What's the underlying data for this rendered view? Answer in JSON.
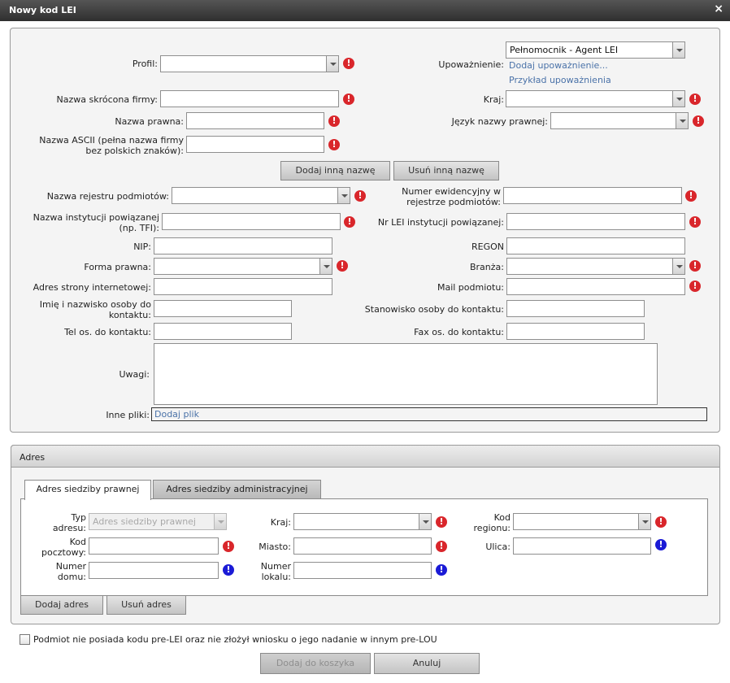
{
  "window": {
    "title": "Nowy kod LEI",
    "close_glyph": "×"
  },
  "form": {
    "profil_label": "Profil:",
    "upowaznienie_label": "Upoważnienie:",
    "upowaznienie_value": "Pełnomocnik - Agent LEI",
    "dodaj_upowaznienie_link": "Dodaj upoważnienie...",
    "przyklad_link": "Przykład upoważnienia",
    "nazwa_skrocona_label": "Nazwa skrócona firmy:",
    "kraj_label": "Kraj:",
    "nazwa_prawna_label": "Nazwa prawna:",
    "jezyk_label": "Język nazwy prawnej:",
    "nazwa_ascii_label_1": "Nazwa ASCII (pełna nazwa firmy",
    "nazwa_ascii_label_2": "bez polskich znaków):",
    "dodaj_nazwe_button": "Dodaj inną nazwę",
    "usun_nazwe_button": "Usuń inną nazwę",
    "nazwa_rejestru_label": "Nazwa rejestru podmiotów:",
    "numer_ewid_label_1": "Numer ewidencyjny w",
    "numer_ewid_label_2": "rejestrze podmiotów:",
    "instytucja_label_1": "Nazwa instytucji powiązanej",
    "instytucja_label_2": "(np. TFI):",
    "nr_lei_label": "Nr LEI instytucji powiązanej:",
    "nip_label": "NIP:",
    "regon_label": "REGON",
    "forma_label": "Forma prawna:",
    "branza_label": "Branża:",
    "www_label": "Adres strony internetowej:",
    "mail_label": "Mail podmiotu:",
    "osoba_label_1": "Imię i nazwisko osoby do",
    "osoba_label_2": "kontaktu:",
    "stanowisko_label": "Stanowisko osoby do kontaktu:",
    "tel_label": "Tel os. do kontaktu:",
    "fax_label": "Fax os. do kontaktu:",
    "uwagi_label": "Uwagi:",
    "pliki_label": "Inne pliki:",
    "dodaj_plik_link": "Dodaj plik"
  },
  "adres": {
    "header": "Adres",
    "tabs": [
      {
        "label": "Adres siedziby prawnej"
      },
      {
        "label": "Adres siedziby administracyjnej"
      }
    ],
    "typ_label_1": "Typ",
    "typ_label_2": "adresu:",
    "typ_value": "Adres siedziby prawnej",
    "kraj_label": "Kraj:",
    "kod_regionu_label_1": "Kod",
    "kod_regionu_label_2": "regionu:",
    "kod_pocztowy_label_1": "Kod",
    "kod_pocztowy_label_2": "pocztowy:",
    "miasto_label": "Miasto:",
    "ulica_label": "Ulica:",
    "numer_domu_label_1": "Numer",
    "numer_domu_label_2": "domu:",
    "numer_lokalu_label_1": "Numer",
    "numer_lokalu_label_2": "lokalu:",
    "dodaj_adres_button": "Dodaj adres",
    "usun_adres_button": "Usuń adres"
  },
  "footer": {
    "checkbox_label": "Podmiot nie posiada kodu pre-LEI oraz nie złożył wniosku o jego nadanie w innym pre-LOU",
    "dodaj_koszyk_button": "Dodaj do koszyka",
    "anuluj_button": "Anuluj"
  },
  "icons": {
    "warn": "!",
    "info": "!"
  },
  "colors": {
    "warn": "#d9262b",
    "info": "#1b1bd6",
    "link": "#4a72a8"
  }
}
